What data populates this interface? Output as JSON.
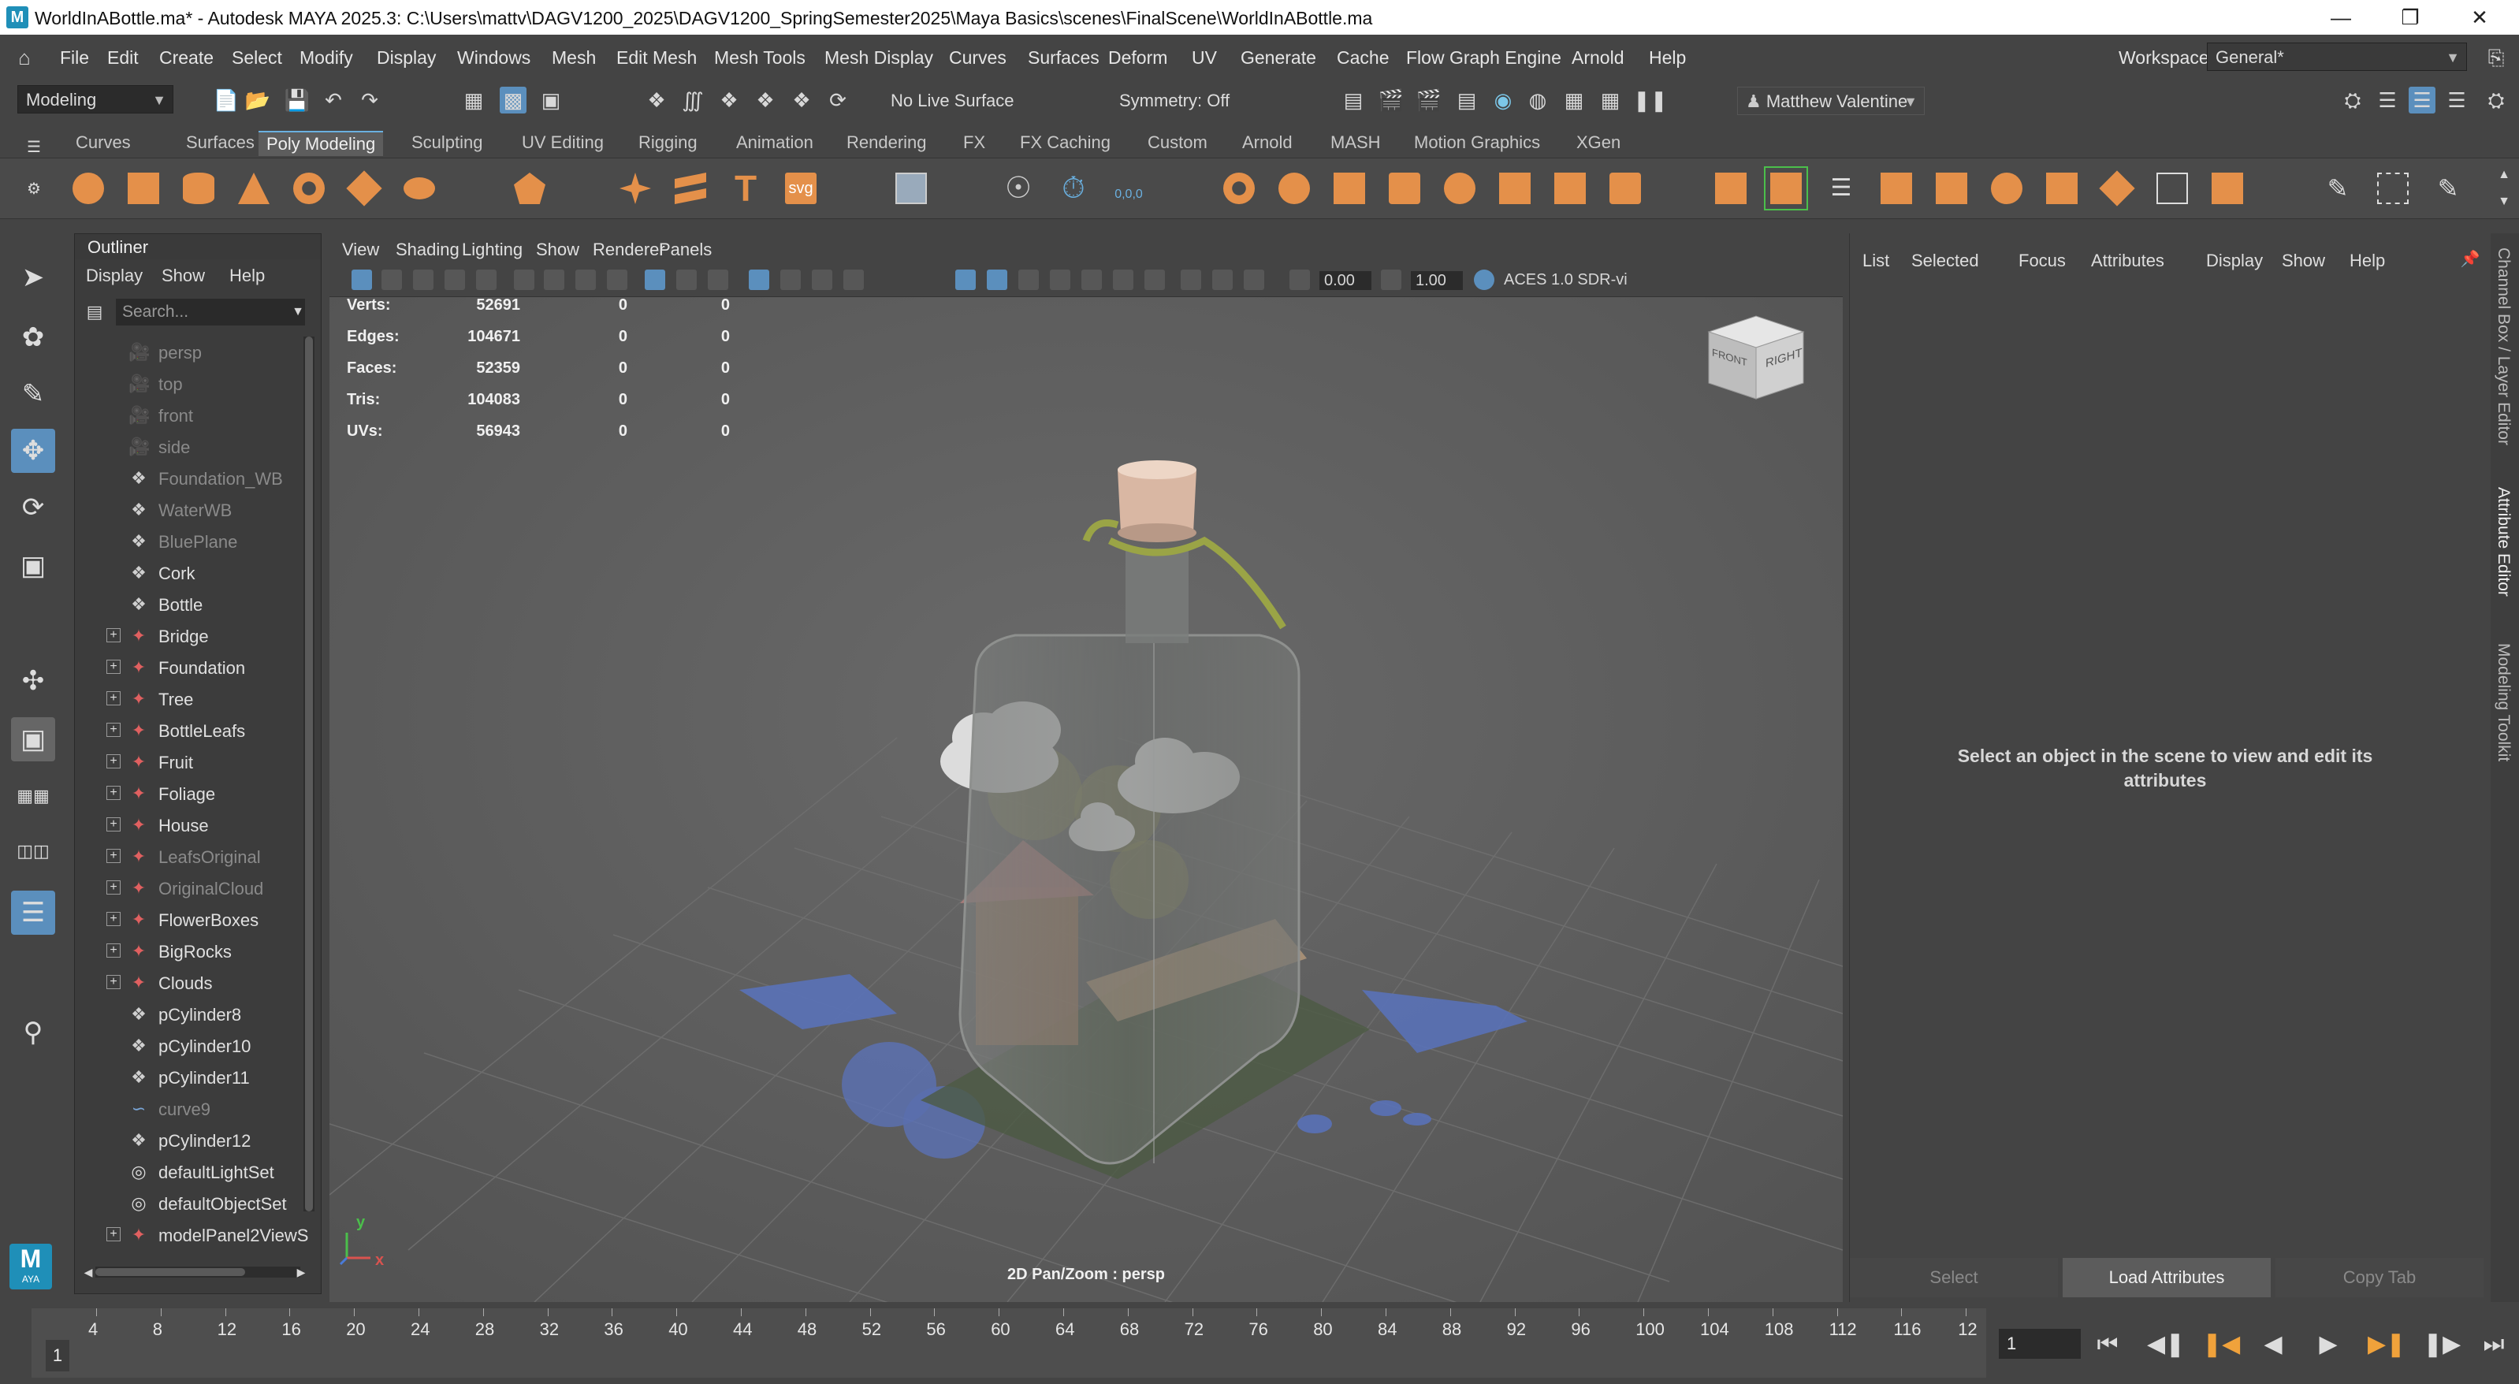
{
  "window": {
    "app_icon": "M",
    "title": "WorldInABottle.ma* - Autodesk MAYA 2025.3: C:\\Users\\mattv\\DAGV1200_2025\\DAGV1200_SpringSemester2025\\Maya Basics\\scenes\\FinalScene\\WorldInABottle.ma",
    "controls": [
      "minimize-icon",
      "maximize-icon",
      "close-icon"
    ]
  },
  "menubar": {
    "items": [
      "File",
      "Edit",
      "Create",
      "Select",
      "Modify",
      "Display",
      "Windows",
      "Mesh",
      "Edit Mesh",
      "Mesh Tools",
      "Mesh Display",
      "Curves",
      "Surfaces",
      "Deform",
      "UV",
      "Generate",
      "Cache",
      "Flow Graph Engine",
      "Arnold",
      "Help"
    ],
    "workspace_label": "Workspace:",
    "workspace_value": "General*"
  },
  "statusline": {
    "menuset": "Modeling",
    "live_surface": "No Live Surface",
    "symmetry": "Symmetry: Off",
    "user": "Matthew Valentine"
  },
  "shelf": {
    "tabs": [
      "Curves",
      "Surfaces",
      "Poly Modeling",
      "Sculpting",
      "UV Editing",
      "Rigging",
      "Animation",
      "Rendering",
      "FX",
      "FX Caching",
      "Custom",
      "Arnold",
      "MASH",
      "Motion Graphics",
      "XGen"
    ],
    "active_tab": "Poly Modeling",
    "icon_text_T": "T",
    "icon_text_svg": "svg",
    "icon_text_coords": "0,0,0"
  },
  "outliner": {
    "title": "Outliner",
    "menus": [
      "Display",
      "Show",
      "Help"
    ],
    "search_placeholder": "Search...",
    "items": [
      {
        "label": "persp",
        "type": "camera",
        "dim": true,
        "expandable": false
      },
      {
        "label": "top",
        "type": "camera",
        "dim": true,
        "expandable": false
      },
      {
        "label": "front",
        "type": "camera",
        "dim": true,
        "expandable": false
      },
      {
        "label": "side",
        "type": "camera",
        "dim": true,
        "expandable": false
      },
      {
        "label": "Foundation_WB",
        "type": "mesh",
        "dim": true,
        "expandable": false
      },
      {
        "label": "WaterWB",
        "type": "mesh",
        "dim": true,
        "expandable": false
      },
      {
        "label": "BluePlane",
        "type": "mesh",
        "dim": true,
        "expandable": false
      },
      {
        "label": "Cork",
        "type": "mesh",
        "dim": false,
        "expandable": false
      },
      {
        "label": "Bottle",
        "type": "mesh",
        "dim": false,
        "expandable": false
      },
      {
        "label": "Bridge",
        "type": "group",
        "dim": false,
        "expandable": true
      },
      {
        "label": "Foundation",
        "type": "group",
        "dim": false,
        "expandable": true
      },
      {
        "label": "Tree",
        "type": "group",
        "dim": false,
        "expandable": true
      },
      {
        "label": "BottleLeafs",
        "type": "group",
        "dim": false,
        "expandable": true
      },
      {
        "label": "Fruit",
        "type": "group",
        "dim": false,
        "expandable": true
      },
      {
        "label": "Foliage",
        "type": "group",
        "dim": false,
        "expandable": true
      },
      {
        "label": "House",
        "type": "group",
        "dim": false,
        "expandable": true
      },
      {
        "label": "LeafsOriginal",
        "type": "group",
        "dim": true,
        "expandable": true
      },
      {
        "label": "OriginalCloud",
        "type": "group",
        "dim": true,
        "expandable": true
      },
      {
        "label": "FlowerBoxes",
        "type": "group",
        "dim": false,
        "expandable": true
      },
      {
        "label": "BigRocks",
        "type": "group",
        "dim": false,
        "expandable": true
      },
      {
        "label": "Clouds",
        "type": "group",
        "dim": false,
        "expandable": true
      },
      {
        "label": "pCylinder8",
        "type": "mesh",
        "dim": false,
        "expandable": false
      },
      {
        "label": "pCylinder10",
        "type": "mesh",
        "dim": false,
        "expandable": false
      },
      {
        "label": "pCylinder11",
        "type": "mesh",
        "dim": false,
        "expandable": false
      },
      {
        "label": "curve9",
        "type": "curve",
        "dim": true,
        "expandable": false
      },
      {
        "label": "pCylinder12",
        "type": "mesh",
        "dim": false,
        "expandable": false
      },
      {
        "label": "defaultLightSet",
        "type": "set",
        "dim": false,
        "expandable": false
      },
      {
        "label": "defaultObjectSet",
        "type": "set",
        "dim": false,
        "expandable": false
      },
      {
        "label": "modelPanel2ViewS",
        "type": "group",
        "dim": false,
        "expandable": true
      }
    ]
  },
  "viewport": {
    "menus": [
      "View",
      "Shading",
      "Lighting",
      "Show",
      "Renderer",
      "Panels"
    ],
    "exposure": "0.00",
    "gamma": "1.00",
    "color_space": "ACES 1.0 SDR-vi",
    "hud_stats": [
      {
        "label": "Verts:",
        "v1": "52691",
        "v2": "0",
        "v3": "0"
      },
      {
        "label": "Edges:",
        "v1": "104671",
        "v2": "0",
        "v3": "0"
      },
      {
        "label": "Faces:",
        "v1": "52359",
        "v2": "0",
        "v3": "0"
      },
      {
        "label": "Tris:",
        "v1": "104083",
        "v2": "0",
        "v3": "0"
      },
      {
        "label": "UVs:",
        "v1": "56943",
        "v2": "0",
        "v3": "0"
      }
    ],
    "viewcube_front": "FRONT",
    "viewcube_right": "RIGHT",
    "camera_label": "2D Pan/Zoom : persp",
    "axis_x": "x",
    "axis_y": "y"
  },
  "attribute_editor": {
    "menus": [
      "List",
      "Selected",
      "Focus",
      "Attributes",
      "Display",
      "Show",
      "Help"
    ],
    "message": "Select an object in the scene to view and edit its attributes",
    "buttons": {
      "select": "Select",
      "load": "Load Attributes",
      "copy": "Copy Tab"
    },
    "side_tabs": [
      "Channel Box / Layer Editor",
      "Attribute Editor",
      "Modeling Toolkit"
    ]
  },
  "timeline": {
    "ticks": [
      "4",
      "8",
      "12",
      "16",
      "20",
      "24",
      "28",
      "32",
      "36",
      "40",
      "44",
      "48",
      "52",
      "56",
      "60",
      "64",
      "68",
      "72",
      "76",
      "80",
      "84",
      "88",
      "92",
      "96",
      "100",
      "104",
      "108",
      "112",
      "116",
      "12"
    ],
    "current_frame": "1",
    "frame_field": "1"
  },
  "maya_logo": {
    "letter": "M",
    "sub": "AYA"
  },
  "colors": {
    "accent_blue": "#5b8fbd",
    "shelf_orange": "#e4904a",
    "playback_orange": "#f0a23b"
  }
}
